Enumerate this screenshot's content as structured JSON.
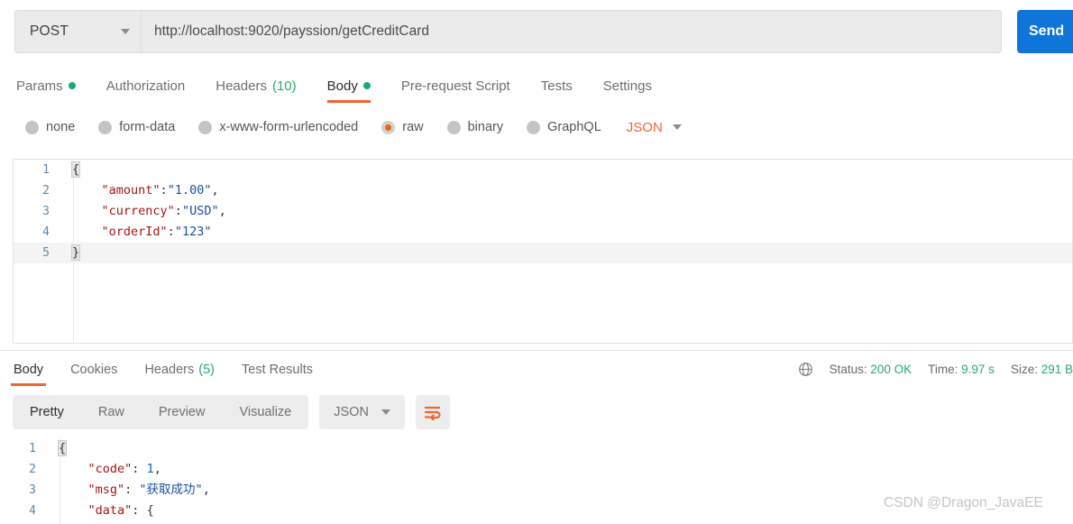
{
  "request": {
    "method": "POST",
    "url": "http://localhost:9020/payssion/getCreditCard",
    "send_label": "Send",
    "tabs": [
      {
        "label": "Params",
        "dot": true,
        "active": false
      },
      {
        "label": "Authorization",
        "dot": false,
        "active": false
      },
      {
        "label": "Headers",
        "count": "(10)",
        "dot": false,
        "active": false
      },
      {
        "label": "Body",
        "dot": true,
        "active": true
      },
      {
        "label": "Pre-request Script",
        "dot": false,
        "active": false
      },
      {
        "label": "Tests",
        "dot": false,
        "active": false
      },
      {
        "label": "Settings",
        "dot": false,
        "active": false
      }
    ],
    "body_types": [
      {
        "label": "none",
        "selected": false
      },
      {
        "label": "form-data",
        "selected": false
      },
      {
        "label": "x-www-form-urlencoded",
        "selected": false
      },
      {
        "label": "raw",
        "selected": true
      },
      {
        "label": "binary",
        "selected": false
      },
      {
        "label": "GraphQL",
        "selected": false
      }
    ],
    "format_label": "JSON",
    "body_lines": [
      {
        "num": "1",
        "tokens": [
          {
            "t": "{",
            "c": "jpun brace-hl"
          }
        ],
        "highlight": false
      },
      {
        "num": "2",
        "tokens": [
          {
            "t": "    ",
            "c": "jpun"
          },
          {
            "t": "\"amount\"",
            "c": "jkey"
          },
          {
            "t": ":",
            "c": "jpun"
          },
          {
            "t": "\"1.00\"",
            "c": "jstr"
          },
          {
            "t": ",",
            "c": "jpun"
          }
        ],
        "highlight": false
      },
      {
        "num": "3",
        "tokens": [
          {
            "t": "    ",
            "c": "jpun"
          },
          {
            "t": "\"currency\"",
            "c": "jkey"
          },
          {
            "t": ":",
            "c": "jpun"
          },
          {
            "t": "\"USD\"",
            "c": "jstr"
          },
          {
            "t": ",",
            "c": "jpun"
          }
        ],
        "highlight": false
      },
      {
        "num": "4",
        "tokens": [
          {
            "t": "    ",
            "c": "jpun"
          },
          {
            "t": "\"orderId\"",
            "c": "jkey"
          },
          {
            "t": ":",
            "c": "jpun"
          },
          {
            "t": "\"123\"",
            "c": "jstr"
          }
        ],
        "highlight": false
      },
      {
        "num": "5",
        "tokens": [
          {
            "t": "}",
            "c": "jpun brace-hl"
          }
        ],
        "highlight": true
      }
    ]
  },
  "response": {
    "tabs": [
      {
        "label": "Body",
        "active": true
      },
      {
        "label": "Cookies",
        "active": false
      },
      {
        "label": "Headers",
        "count": "(5)",
        "active": false
      },
      {
        "label": "Test Results",
        "active": false
      }
    ],
    "meta": {
      "status_label": "Status:",
      "status_value": "200 OK",
      "time_label": "Time:",
      "time_value": "9.97 s",
      "size_label": "Size:",
      "size_value": "291 B"
    },
    "view_modes": [
      {
        "label": "Pretty",
        "active": true
      },
      {
        "label": "Raw",
        "active": false
      },
      {
        "label": "Preview",
        "active": false
      },
      {
        "label": "Visualize",
        "active": false
      }
    ],
    "format_label": "JSON",
    "body_lines": [
      {
        "num": "1",
        "tokens": [
          {
            "t": "{",
            "c": "jpun brace-hl"
          }
        ],
        "highlight": false
      },
      {
        "num": "2",
        "tokens": [
          {
            "t": "    ",
            "c": "jpun"
          },
          {
            "t": "\"code\"",
            "c": "jkey"
          },
          {
            "t": ": ",
            "c": "jpun"
          },
          {
            "t": "1",
            "c": "jnum"
          },
          {
            "t": ",",
            "c": "jpun"
          }
        ],
        "highlight": false
      },
      {
        "num": "3",
        "tokens": [
          {
            "t": "    ",
            "c": "jpun"
          },
          {
            "t": "\"msg\"",
            "c": "jkey"
          },
          {
            "t": ": ",
            "c": "jpun"
          },
          {
            "t": "\"获取成功\"",
            "c": "jstr"
          },
          {
            "t": ",",
            "c": "jpun"
          }
        ],
        "highlight": false
      },
      {
        "num": "4",
        "tokens": [
          {
            "t": "    ",
            "c": "jpun"
          },
          {
            "t": "\"data\"",
            "c": "jkey"
          },
          {
            "t": ": ",
            "c": "jpun"
          },
          {
            "t": "{",
            "c": "jpun"
          }
        ],
        "highlight": false
      }
    ]
  },
  "watermark": "CSDN @Dragon_JavaEE",
  "colors": {
    "accent_orange": "#ef6532",
    "send_blue": "#1075d8",
    "status_green": "#2aa86a",
    "radio_selected": "#f2600c"
  }
}
